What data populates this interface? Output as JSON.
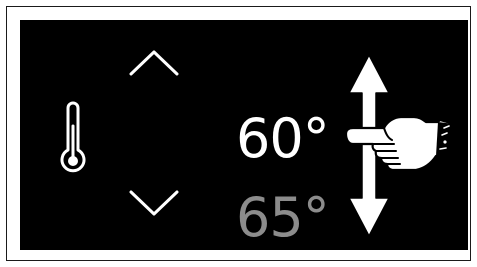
{
  "thermostat": {
    "current_temp": "60°",
    "next_temp": "65°"
  },
  "icons": {
    "increase": "chevron-up-icon",
    "decrease": "chevron-down-icon",
    "temperature": "thermometer-icon",
    "swipe_hint": "vertical-swipe-arrow-icon",
    "gesture": "pointing-hand-icon"
  },
  "colors": {
    "screen_background": "#000000",
    "current_temp": "#ffffff",
    "next_temp": "#8c8c8c"
  }
}
